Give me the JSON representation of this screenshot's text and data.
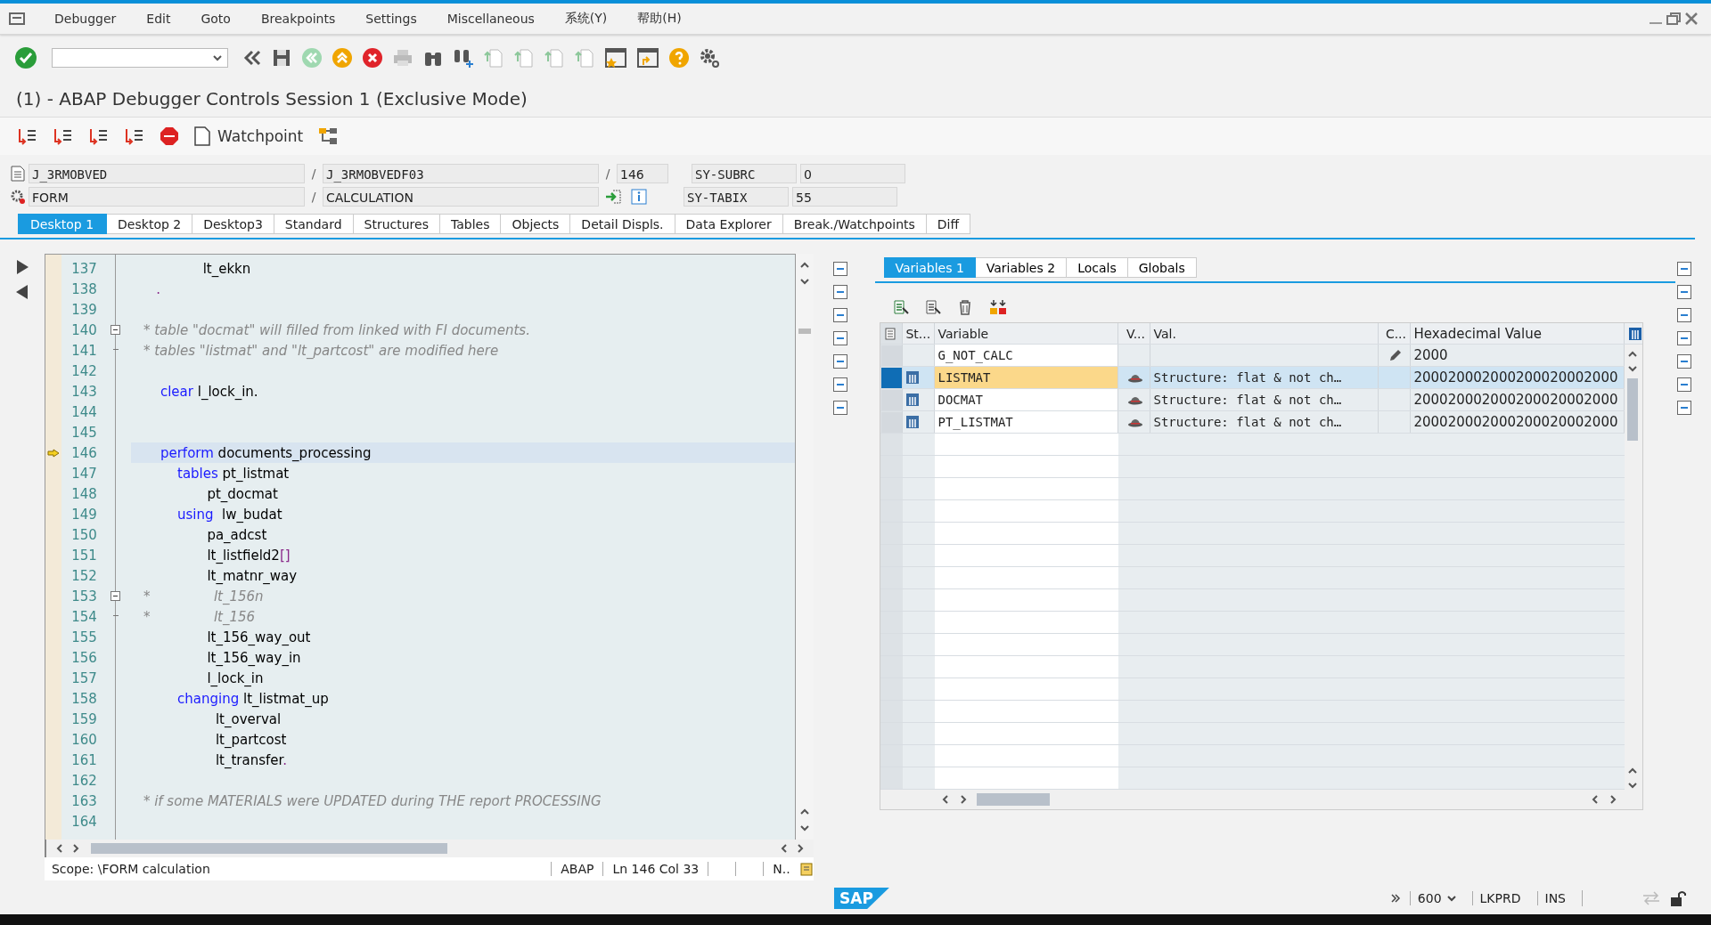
{
  "menu": [
    "Debugger",
    "Edit",
    "Goto",
    "Breakpoints",
    "Settings",
    "Miscellaneous",
    "系统(Y)",
    "帮助(H)"
  ],
  "title": "(1) - ABAP Debugger Controls Session 1 (Exclusive Mode)",
  "app_toolbar": {
    "watchpoint": "Watchpoint"
  },
  "fields": [
    {
      "program": "J_3RMOBVED",
      "sep1": "/",
      "include": "J_3RMOBVEDF03",
      "sep2": "/",
      "line": "146",
      "sys_name": "SY-SUBRC",
      "sys_value": "0"
    },
    {
      "program": "FORM",
      "sep1": "/",
      "include": "CALCULATION",
      "sys_name": "SY-TABIX",
      "sys_value": "55"
    }
  ],
  "desktop_tabs": [
    {
      "label": "Desktop 1",
      "selected": true
    },
    {
      "label": "Desktop 2",
      "selected": false
    },
    {
      "label": "Desktop3",
      "selected": false
    },
    {
      "label": "Standard",
      "selected": false
    },
    {
      "label": "Structures",
      "selected": false
    },
    {
      "label": "Tables",
      "selected": false
    },
    {
      "label": "Objects",
      "selected": false
    },
    {
      "label": "Detail Displs.",
      "selected": false
    },
    {
      "label": "Data Explorer",
      "selected": false
    },
    {
      "label": "Break./Watchpoints",
      "selected": false
    },
    {
      "label": "Diff",
      "selected": false
    }
  ],
  "code_lines": [
    {
      "number": "137",
      "kind": "code",
      "current": false,
      "segments": [
        {
          "kind": "id",
          "text": "              lt_ekkn"
        }
      ]
    },
    {
      "number": "138",
      "kind": "code",
      "current": false,
      "segments": [
        {
          "kind": "pt",
          "text": "   ."
        }
      ]
    },
    {
      "number": "139",
      "kind": "code",
      "current": false
    },
    {
      "number": "140",
      "kind": "fold_start",
      "current": false,
      "segments": [
        {
          "kind": "cm",
          "text": "* table \"docmat\" will filled from linked with FI documents."
        }
      ]
    },
    {
      "number": "141",
      "kind": "fold_end",
      "current": false,
      "segments": [
        {
          "kind": "cm",
          "text": "* tables \"listmat\" and \"lt_partcost\" are modified here"
        }
      ]
    },
    {
      "number": "142",
      "kind": "code",
      "current": false
    },
    {
      "number": "143",
      "kind": "code",
      "current": false,
      "segments": [
        {
          "kind": "kw",
          "text": "    clear"
        },
        {
          "kind": "id",
          "text": " l_lock_in."
        }
      ]
    },
    {
      "number": "144",
      "kind": "code",
      "current": false
    },
    {
      "number": "145",
      "kind": "code",
      "current": false
    },
    {
      "number": "146",
      "kind": "code",
      "current": true,
      "segments": [
        {
          "kind": "kw",
          "text": "    perform"
        },
        {
          "kind": "id",
          "text": " documents_processing"
        }
      ]
    },
    {
      "number": "147",
      "kind": "code",
      "current": false,
      "segments": [
        {
          "kind": "kw",
          "text": "        tables"
        },
        {
          "kind": "id",
          "text": " pt_listmat"
        }
      ]
    },
    {
      "number": "148",
      "kind": "code",
      "current": false,
      "segments": [
        {
          "kind": "id",
          "text": "               pt_docmat"
        }
      ]
    },
    {
      "number": "149",
      "kind": "code",
      "current": false,
      "segments": [
        {
          "kind": "kw",
          "text": "        using"
        },
        {
          "kind": "id",
          "text": "  lw_budat"
        }
      ]
    },
    {
      "number": "150",
      "kind": "code",
      "current": false,
      "segments": [
        {
          "kind": "id",
          "text": "               pa_adcst"
        }
      ]
    },
    {
      "number": "151",
      "kind": "code",
      "current": false,
      "segments": [
        {
          "kind": "id",
          "text": "               lt_listfield2"
        },
        {
          "kind": "pt",
          "text": "[]"
        }
      ]
    },
    {
      "number": "152",
      "kind": "code",
      "current": false,
      "segments": [
        {
          "kind": "id",
          "text": "               lt_matnr_way"
        }
      ]
    },
    {
      "number": "153",
      "kind": "fold_start",
      "current": false,
      "segments": [
        {
          "kind": "cm",
          "text": "*               lt_156n"
        }
      ]
    },
    {
      "number": "154",
      "kind": "fold_end",
      "current": false,
      "segments": [
        {
          "kind": "cm",
          "text": "*               lt_156"
        }
      ]
    },
    {
      "number": "155",
      "kind": "code",
      "current": false,
      "segments": [
        {
          "kind": "id",
          "text": "               lt_156_way_out"
        }
      ]
    },
    {
      "number": "156",
      "kind": "code",
      "current": false,
      "segments": [
        {
          "kind": "id",
          "text": "               lt_156_way_in"
        }
      ]
    },
    {
      "number": "157",
      "kind": "code",
      "current": false,
      "segments": [
        {
          "kind": "id",
          "text": "               l_lock_in"
        }
      ]
    },
    {
      "number": "158",
      "kind": "code",
      "current": false,
      "segments": [
        {
          "kind": "kw",
          "text": "        changing"
        },
        {
          "kind": "id",
          "text": " lt_listmat_up"
        }
      ]
    },
    {
      "number": "159",
      "kind": "code",
      "current": false,
      "segments": [
        {
          "kind": "id",
          "text": "                 lt_overval"
        }
      ]
    },
    {
      "number": "160",
      "kind": "code",
      "current": false,
      "segments": [
        {
          "kind": "id",
          "text": "                 lt_partcost"
        }
      ]
    },
    {
      "number": "161",
      "kind": "code",
      "current": false,
      "segments": [
        {
          "kind": "id",
          "text": "                 lt_transfer"
        },
        {
          "kind": "pt",
          "text": "."
        }
      ]
    },
    {
      "number": "162",
      "kind": "code",
      "current": false
    },
    {
      "number": "163",
      "kind": "code",
      "current": false,
      "segments": [
        {
          "kind": "cm",
          "text": "* if some MATERIALS were UPDATED during THE report PROCESSING"
        }
      ]
    },
    {
      "number": "164",
      "kind": "code",
      "current": false
    }
  ],
  "code_status": {
    "scope": "Scope: \\FORM calculation",
    "language": "ABAP",
    "position": "Ln 146 Col  33",
    "more": "N.."
  },
  "variable_tabs": [
    {
      "label": "Variables 1",
      "selected": true
    },
    {
      "label": "Variables 2",
      "selected": false
    },
    {
      "label": "Locals",
      "selected": false
    },
    {
      "label": "Globals",
      "selected": false
    }
  ],
  "table": {
    "columns": [
      "St...",
      "Variable",
      "V...",
      "Val.",
      "C...",
      "Hexadecimal Value"
    ],
    "rows": [
      {
        "kind": "simple",
        "selected": false,
        "variable": "G_NOT_CALC",
        "hex": "2000"
      },
      {
        "kind": "structure",
        "selected": true,
        "variable": "LISTMAT",
        "value": "Structure: flat & not ch…",
        "hex": "200020002000200020002000"
      },
      {
        "kind": "structure",
        "selected": false,
        "variable": "DOCMAT",
        "value": "Structure: flat & not ch…",
        "hex": "200020002000200020002000"
      },
      {
        "kind": "structure",
        "selected": false,
        "variable": "PT_LISTMAT",
        "value": "Structure: flat & not ch…",
        "hex": "200020002000200020002000"
      }
    ]
  },
  "status_bar": {
    "client": "600",
    "system": "LKPRD",
    "mode": "INS",
    "logo": "SAP"
  }
}
